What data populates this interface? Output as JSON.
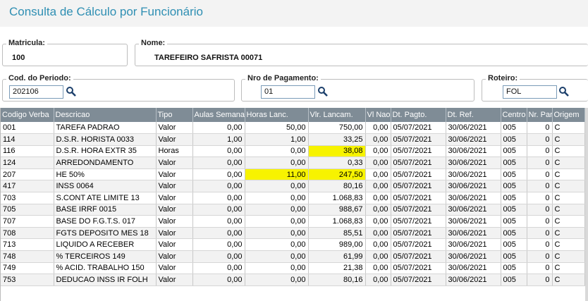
{
  "title": "Consulta de Cálculo por Funcionário",
  "matricula": {
    "label": "Matricula:",
    "value": "100"
  },
  "nome": {
    "label": "Nome:",
    "value": "TAREFEIRO SAFRISTA 00071"
  },
  "periodo": {
    "label": "Cod. do Periodo:",
    "value": "202106"
  },
  "pagamento": {
    "label": "Nro de Pagamento:",
    "value": "01"
  },
  "roteiro": {
    "label": "Roteiro:",
    "value": "FOL"
  },
  "columns": [
    "Codigo Verba",
    "Descricao",
    "Tipo",
    "Aulas Semana",
    "Horas Lanc.",
    "Vlr. Lancam.",
    "Vl Nao",
    "Dt. Pagto.",
    "Dt. Ref.",
    "Centro",
    "Nr. Parc",
    "Origem"
  ],
  "rows": [
    [
      "001",
      "TAREFA PADRAO",
      "Valor",
      "0,00",
      "50,00",
      "750,00",
      "0,00",
      "05/07/2021",
      "30/06/2021",
      "005",
      "0",
      "C"
    ],
    [
      "114",
      "D.S.R. HORISTA  0033",
      "Valor",
      "1,00",
      "1,00",
      "33,25",
      "0,00",
      "05/07/2021",
      "30/06/2021",
      "005",
      "0",
      "C"
    ],
    [
      "116",
      "D.S.R. HORA EXTR  35",
      "Horas",
      "0,00",
      "0,00",
      "38,08",
      "0,00",
      "05/07/2021",
      "30/06/2021",
      "005",
      "0",
      "C"
    ],
    [
      "124",
      "ARREDONDAMENTO",
      "Valor",
      "0,00",
      "0,00",
      "0,33",
      "0,00",
      "05/07/2021",
      "30/06/2021",
      "005",
      "0",
      "C"
    ],
    [
      "207",
      "HE  50%",
      "Valor",
      "0,00",
      "11,00",
      "247,50",
      "0,00",
      "05/07/2021",
      "30/06/2021",
      "005",
      "0",
      "C"
    ],
    [
      "417",
      "INSS 0064",
      "Valor",
      "0,00",
      "0,00",
      "80,16",
      "0,00",
      "05/07/2021",
      "30/06/2021",
      "005",
      "0",
      "C"
    ],
    [
      "703",
      "S.CONT ATE LIMITE 13",
      "Valor",
      "0,00",
      "0,00",
      "1.068,83",
      "0,00",
      "05/07/2021",
      "30/06/2021",
      "005",
      "0",
      "C"
    ],
    [
      "705",
      "BASE IRRF 0015",
      "Valor",
      "0,00",
      "0,00",
      "988,67",
      "0,00",
      "05/07/2021",
      "30/06/2021",
      "005",
      "0",
      "C"
    ],
    [
      "707",
      "BASE DO F.G.T.S. 017",
      "Valor",
      "0,00",
      "0,00",
      "1.068,83",
      "0,00",
      "05/07/2021",
      "30/06/2021",
      "005",
      "0",
      "C"
    ],
    [
      "708",
      "FGTS DEPOSITO MES 18",
      "Valor",
      "0,00",
      "0,00",
      "85,51",
      "0,00",
      "05/07/2021",
      "30/06/2021",
      "005",
      "0",
      "C"
    ],
    [
      "713",
      "LIQUIDO A RECEBER",
      "Valor",
      "0,00",
      "0,00",
      "989,00",
      "0,00",
      "05/07/2021",
      "30/06/2021",
      "005",
      "0",
      "C"
    ],
    [
      "748",
      "% TERCEIROS 149",
      "Valor",
      "0,00",
      "0,00",
      "61,99",
      "0,00",
      "05/07/2021",
      "30/06/2021",
      "005",
      "0",
      "C"
    ],
    [
      "749",
      "% ACID. TRABALHO 150",
      "Valor",
      "0,00",
      "0,00",
      "21,38",
      "0,00",
      "05/07/2021",
      "30/06/2021",
      "005",
      "0",
      "C"
    ],
    [
      "753",
      "DEDUCAO INSS IR FOLH",
      "Valor",
      "0,00",
      "0,00",
      "80,16",
      "0,00",
      "05/07/2021",
      "30/06/2021",
      "005",
      "0",
      "C"
    ]
  ],
  "highlights": [
    [
      2,
      5
    ],
    [
      4,
      4
    ],
    [
      4,
      5
    ]
  ],
  "colors": {
    "title": "#2f8fb3",
    "header_bg": "#7f8c96",
    "highlight": "#f7f300"
  }
}
